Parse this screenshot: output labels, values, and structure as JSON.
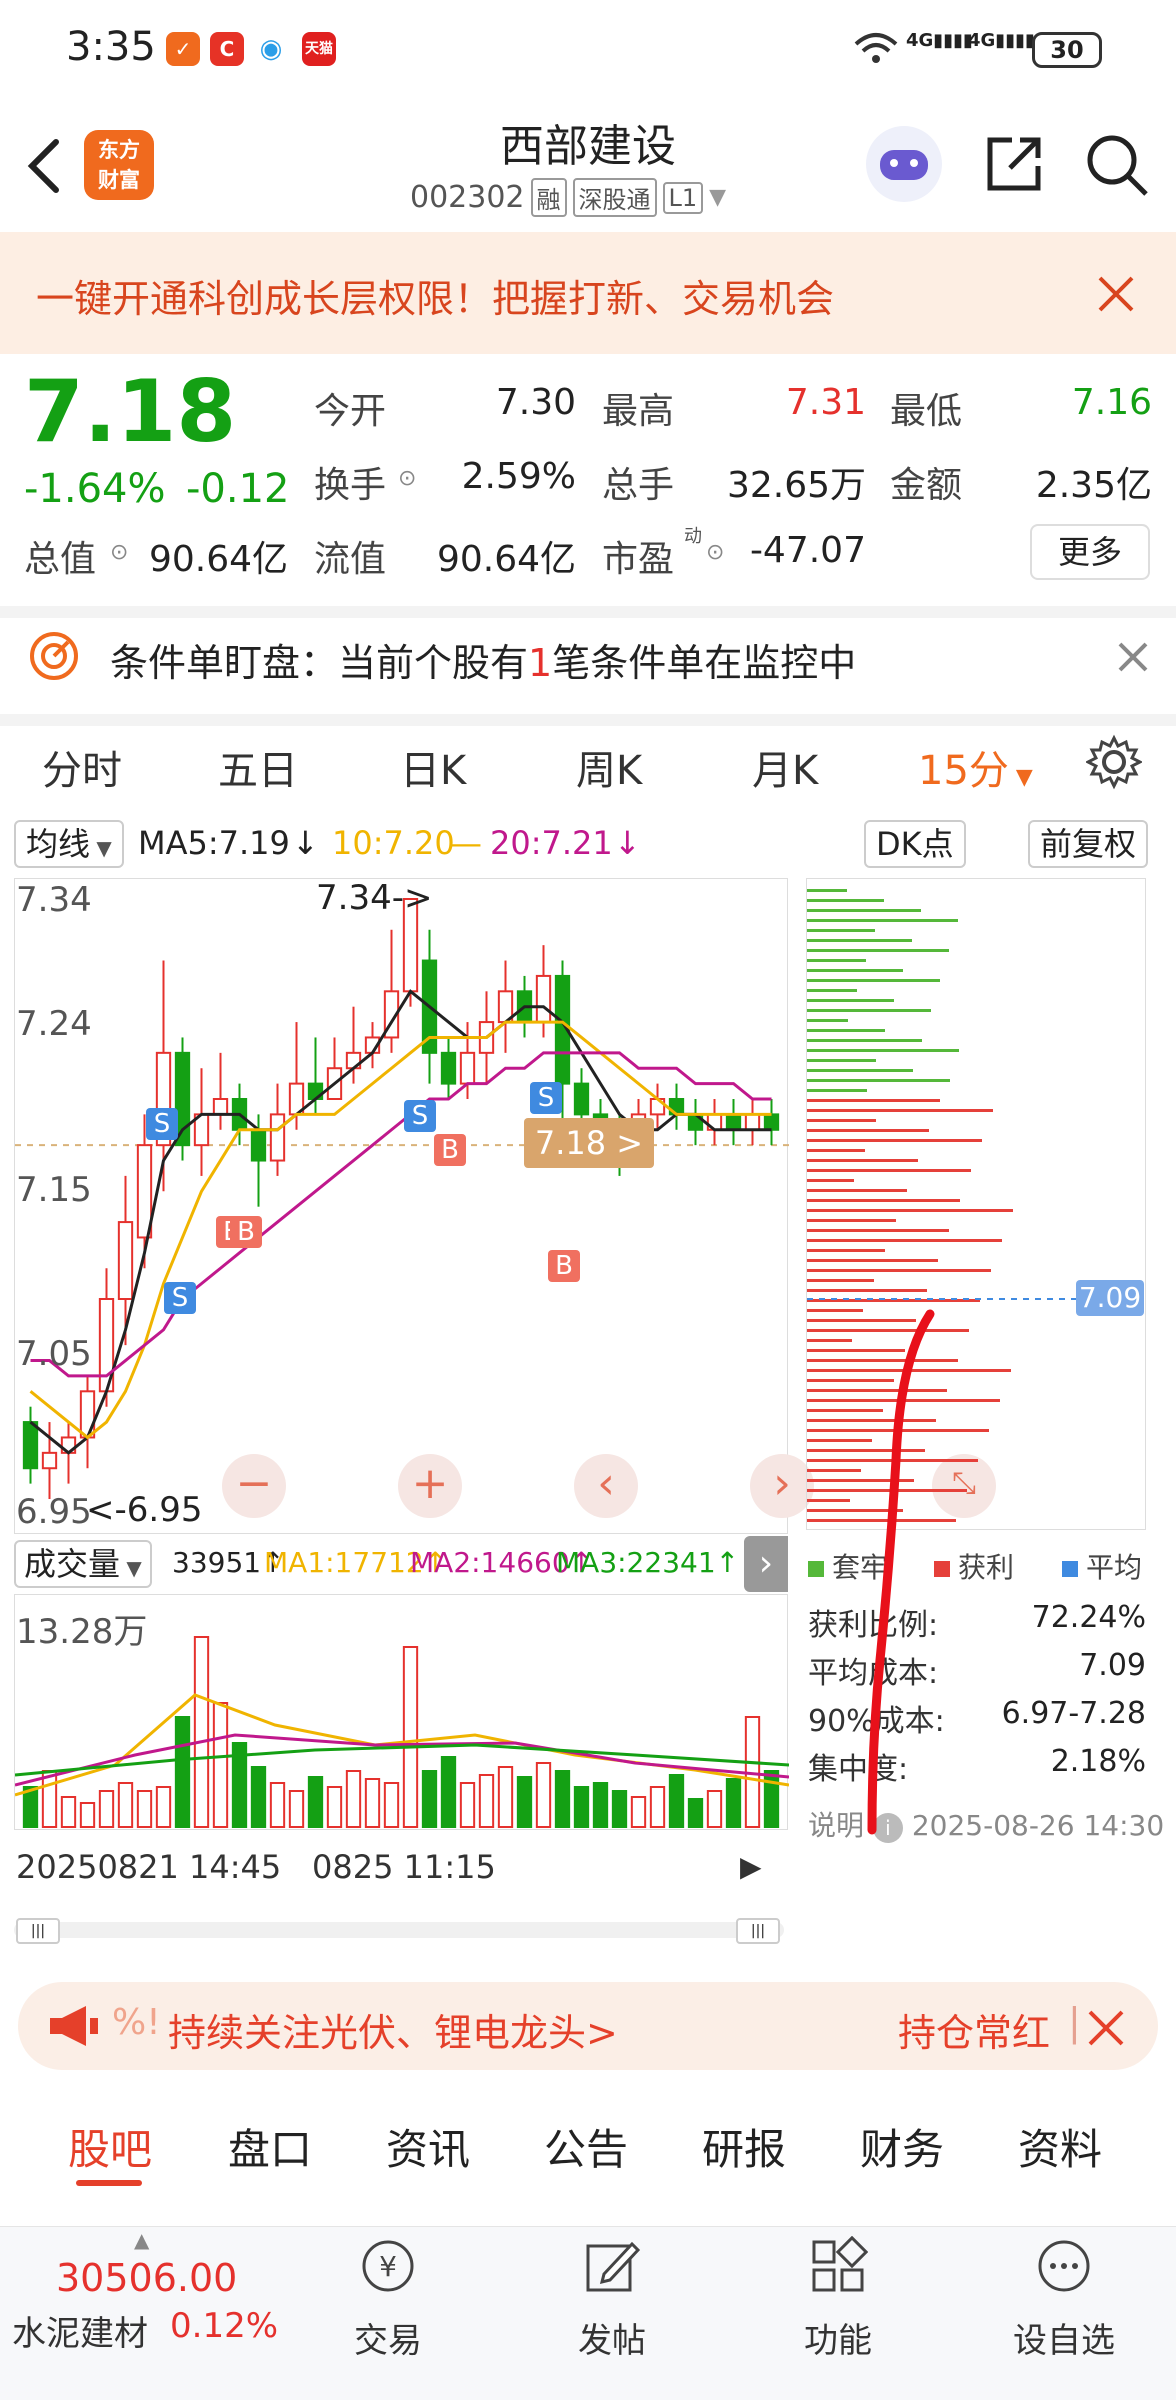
{
  "status": {
    "time": "3:35",
    "app_icons": [
      "D",
      "C",
      "◉",
      "天猫"
    ],
    "network": "4G",
    "battery": "30"
  },
  "header": {
    "logo_line1": "东方",
    "logo_line2": "财富",
    "stock_name": "西部建设",
    "stock_code": "002302",
    "tags": [
      "融",
      "深股通",
      "L1"
    ]
  },
  "banner": {
    "text": "一键开通科创成长层权限！把握打新、交易机会"
  },
  "quote": {
    "price": "7.18",
    "change_pct": "-1.64%",
    "change_amt": "-0.12",
    "open_label": "今开",
    "open": "7.30",
    "high_label": "最高",
    "high": "7.31",
    "low_label": "最低",
    "low": "7.16",
    "turnover_label": "换手",
    "turnover": "2.59%",
    "volume_label": "总手",
    "volume": "32.65万",
    "amount_label": "金额",
    "amount": "2.35亿",
    "mktcap_label": "总值",
    "mktcap": "90.64亿",
    "float_label": "流值",
    "float": "90.64亿",
    "pe_label": "市盈",
    "pe_sup": "动",
    "pe": "-47.07",
    "more": "更多"
  },
  "condition": {
    "prefix": "条件单盯盘：当前个股有",
    "count": "1",
    "suffix": "笔条件单在监控中"
  },
  "chart_tabs": [
    "分时",
    "五日",
    "日K",
    "周K",
    "月K",
    "15分"
  ],
  "ma_row": {
    "selector": "均线",
    "ma5": "MA5:7.19",
    "ma10": "10:7.20",
    "ma20": "20:7.21",
    "dk": "DK点",
    "adjust": "前复权"
  },
  "chart": {
    "y_labels": [
      "7.34",
      "7.24",
      "7.15",
      "7.05",
      "6.95"
    ],
    "max_note": "7.34->",
    "min_note": "<-6.95",
    "price_tag": "7.18 >",
    "buy_marker": "B",
    "sell_marker": "S",
    "controls": [
      "−",
      "+",
      "‹",
      "›"
    ]
  },
  "volume": {
    "selector": "成交量",
    "vol": "33951",
    "ma1": "MA1:17712",
    "ma2": "MA2:14660",
    "ma3": "MA3:22341",
    "top_label": "13.28万",
    "date_left": "20250821 14:45",
    "date_mid": "0825 11:15"
  },
  "distribution": {
    "avg_tag": "7.09",
    "legend": [
      "套牢",
      "获利",
      "平均"
    ],
    "stats": [
      {
        "label": "获利比例:",
        "value": "72.24%"
      },
      {
        "label": "平均成本:",
        "value": "7.09"
      },
      {
        "label": "90%成本:",
        "value": "6.97-7.28"
      },
      {
        "label": "集中度:",
        "value": "2.18%"
      }
    ],
    "note_label": "说明",
    "note_time": "2025-08-26 14:30"
  },
  "promo": {
    "text": "持续关注光伏、锂电龙头>",
    "right": "持仓常红",
    "prefix": "%!"
  },
  "bottom_tabs": [
    "股吧",
    "盘口",
    "资讯",
    "公告",
    "研报",
    "财务",
    "资料"
  ],
  "bottom_bar": {
    "index_value": "30506.00",
    "index_name": "水泥建材",
    "index_change": "0.12%",
    "items": [
      "交易",
      "发帖",
      "功能",
      "设自选"
    ]
  },
  "colors": {
    "up": "#e5312d",
    "down": "#14a014",
    "accent": "#f06a1e",
    "ma5": "#222222",
    "ma10": "#f0b400",
    "ma20": "#c0188c"
  },
  "chart_data": {
    "type": "candlestick",
    "interval": "15分",
    "ylim": [
      6.95,
      7.34
    ],
    "ma_lines": [
      "MA5",
      "10",
      "20"
    ]
  }
}
